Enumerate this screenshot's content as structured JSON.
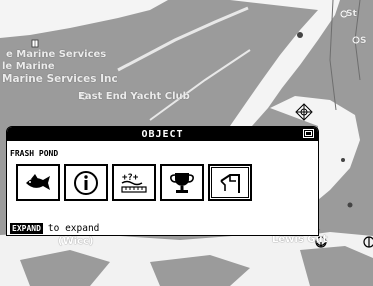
{
  "map": {
    "labels": [
      "e Marine Services",
      "le Marine",
      "Marine Services Inc",
      "East End Yacht Club",
      "St",
      "S",
      "(Wicc)",
      "Lewis Gut"
    ]
  },
  "dialog": {
    "title": "OBJECT",
    "object_name": "FRASH POND",
    "icons": [
      "fish-icon",
      "info-icon",
      "tide-gauge-icon",
      "trophy-icon",
      "marine-service-icon"
    ],
    "footer": {
      "key": "EXPAND",
      "text": "to expand"
    }
  },
  "colors": {
    "land": "#9b9b9b",
    "water": "#f4f4f4",
    "dialog_header": "#000000"
  }
}
